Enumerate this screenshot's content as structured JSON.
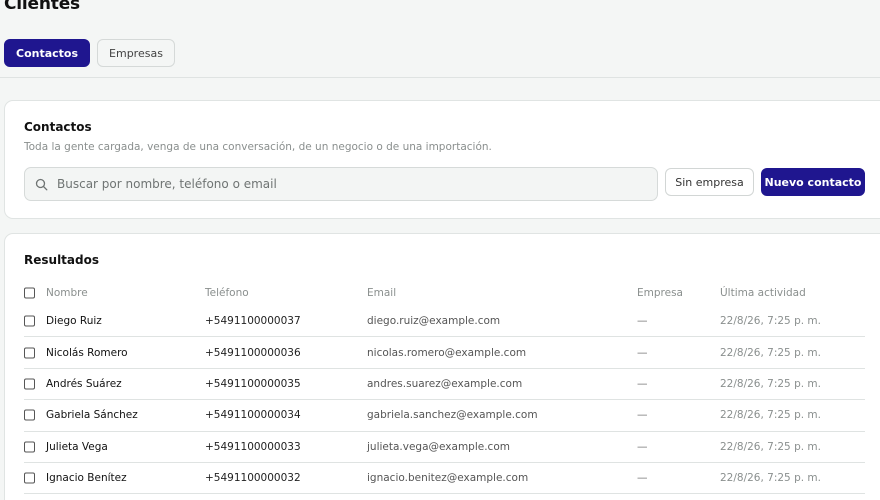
{
  "page": {
    "title": "Clientes"
  },
  "tabs": [
    {
      "label": "Contactos",
      "active": true
    },
    {
      "label": "Empresas",
      "active": false
    }
  ],
  "contacts_card": {
    "title": "Contactos",
    "subtitle": "Toda la gente cargada, venga de una conversación, de un negocio o de una importación.",
    "search_placeholder": "Buscar por nombre, teléfono o email",
    "search_value": "",
    "sin_empresa_label": "Sin empresa",
    "nuevo_contacto_label": "Nuevo contacto"
  },
  "results": {
    "title": "Resultados",
    "columns": {
      "name": "Nombre",
      "phone": "Teléfono",
      "email": "Email",
      "company": "Empresa",
      "activity": "Última actividad"
    },
    "rows": [
      {
        "name": "Diego Ruiz",
        "phone": "+5491100000037",
        "email": "diego.ruiz@example.com",
        "company": "—",
        "activity": "22/8/26, 7:25 p. m."
      },
      {
        "name": "Nicolás Romero",
        "phone": "+5491100000036",
        "email": "nicolas.romero@example.com",
        "company": "—",
        "activity": "22/8/26, 7:25 p. m."
      },
      {
        "name": "Andrés Suárez",
        "phone": "+5491100000035",
        "email": "andres.suarez@example.com",
        "company": "—",
        "activity": "22/8/26, 7:25 p. m."
      },
      {
        "name": "Gabriela Sánchez",
        "phone": "+5491100000034",
        "email": "gabriela.sanchez@example.com",
        "company": "—",
        "activity": "22/8/26, 7:25 p. m."
      },
      {
        "name": "Julieta Vega",
        "phone": "+5491100000033",
        "email": "julieta.vega@example.com",
        "company": "—",
        "activity": "22/8/26, 7:25 p. m."
      },
      {
        "name": "Ignacio Benítez",
        "phone": "+5491100000032",
        "email": "ignacio.benitez@example.com",
        "company": "—",
        "activity": "22/8/26, 7:25 p. m."
      }
    ]
  },
  "colors": {
    "accent": "#1f168f",
    "background": "#f4f6f5"
  },
  "icons": {
    "search": "search-icon"
  }
}
